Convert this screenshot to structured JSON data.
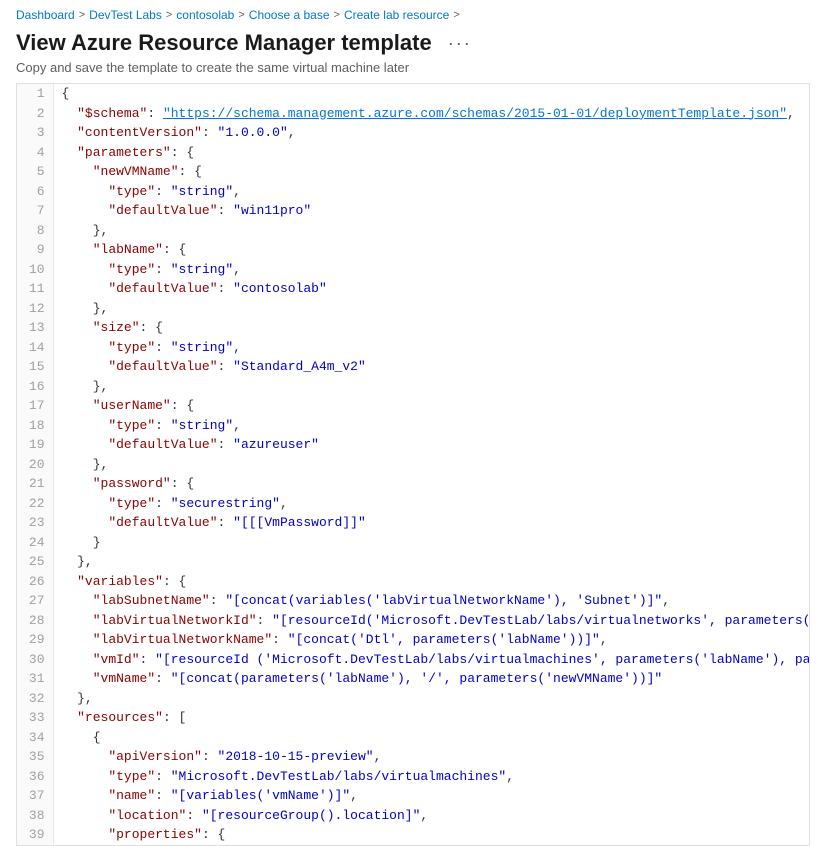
{
  "breadcrumb": {
    "items": [
      {
        "label": "Dashboard",
        "href": true
      },
      {
        "label": "DevTest Labs",
        "href": true
      },
      {
        "label": "contosolab",
        "href": true
      },
      {
        "label": "Choose a base",
        "href": true
      },
      {
        "label": "Create lab resource",
        "href": true
      }
    ],
    "sep": ">"
  },
  "header": {
    "title": "View Azure Resource Manager template",
    "more_label": "···",
    "subtitle": "Copy and save the template to create the same virtual machine later"
  },
  "code": {
    "lines": [
      {
        "num": 1,
        "content": "{"
      },
      {
        "num": 2,
        "content": "  \"$schema\": \"https://schema.management.azure.com/schemas/2015-01-01/deploymentTemplate.json\","
      },
      {
        "num": 3,
        "content": "  \"contentVersion\": \"1.0.0.0\","
      },
      {
        "num": 4,
        "content": "  \"parameters\": {"
      },
      {
        "num": 5,
        "content": "    \"newVMName\": {"
      },
      {
        "num": 6,
        "content": "      \"type\": \"string\","
      },
      {
        "num": 7,
        "content": "      \"defaultValue\": \"win11pro\""
      },
      {
        "num": 8,
        "content": "    },"
      },
      {
        "num": 9,
        "content": "    \"labName\": {"
      },
      {
        "num": 10,
        "content": "      \"type\": \"string\","
      },
      {
        "num": 11,
        "content": "      \"defaultValue\": \"contosolab\""
      },
      {
        "num": 12,
        "content": "    },"
      },
      {
        "num": 13,
        "content": "    \"size\": {"
      },
      {
        "num": 14,
        "content": "      \"type\": \"string\","
      },
      {
        "num": 15,
        "content": "      \"defaultValue\": \"Standard_A4m_v2\""
      },
      {
        "num": 16,
        "content": "    },"
      },
      {
        "num": 17,
        "content": "    \"userName\": {"
      },
      {
        "num": 18,
        "content": "      \"type\": \"string\","
      },
      {
        "num": 19,
        "content": "      \"defaultValue\": \"azureuser\""
      },
      {
        "num": 20,
        "content": "    },"
      },
      {
        "num": 21,
        "content": "    \"password\": {"
      },
      {
        "num": 22,
        "content": "      \"type\": \"securestring\","
      },
      {
        "num": 23,
        "content": "      \"defaultValue\": \"[[[VmPassword]]\""
      },
      {
        "num": 24,
        "content": "    }"
      },
      {
        "num": 25,
        "content": "  },"
      },
      {
        "num": 26,
        "content": "  \"variables\": {"
      },
      {
        "num": 27,
        "content": "    \"labSubnetName\": \"[concat(variables('labVirtualNetworkName'), 'Subnet')]\","
      },
      {
        "num": 28,
        "content": "    \"labVirtualNetworkId\": \"[resourceId('Microsoft.DevTestLab/labs/virtualnetworks', parameters('lab"
      },
      {
        "num": 29,
        "content": "    \"labVirtualNetworkName\": \"[concat('Dtl', parameters('labName'))]\","
      },
      {
        "num": 30,
        "content": "    \"vmId\": \"[resourceId ('Microsoft.DevTestLab/labs/virtualmachines', parameters('labName'), parame"
      },
      {
        "num": 31,
        "content": "    \"vmName\": \"[concat(parameters('labName'), '/', parameters('newVMName'))]\""
      },
      {
        "num": 32,
        "content": "  },"
      },
      {
        "num": 33,
        "content": "  \"resources\": ["
      },
      {
        "num": 34,
        "content": "    {"
      },
      {
        "num": 35,
        "content": "      \"apiVersion\": \"2018-10-15-preview\","
      },
      {
        "num": 36,
        "content": "      \"type\": \"Microsoft.DevTestLab/labs/virtualmachines\","
      },
      {
        "num": 37,
        "content": "      \"name\": \"[variables('vmName')]\","
      },
      {
        "num": 38,
        "content": "      \"location\": \"[resourceGroup().location]\","
      },
      {
        "num": 39,
        "content": "      \"properties\": {"
      }
    ]
  }
}
